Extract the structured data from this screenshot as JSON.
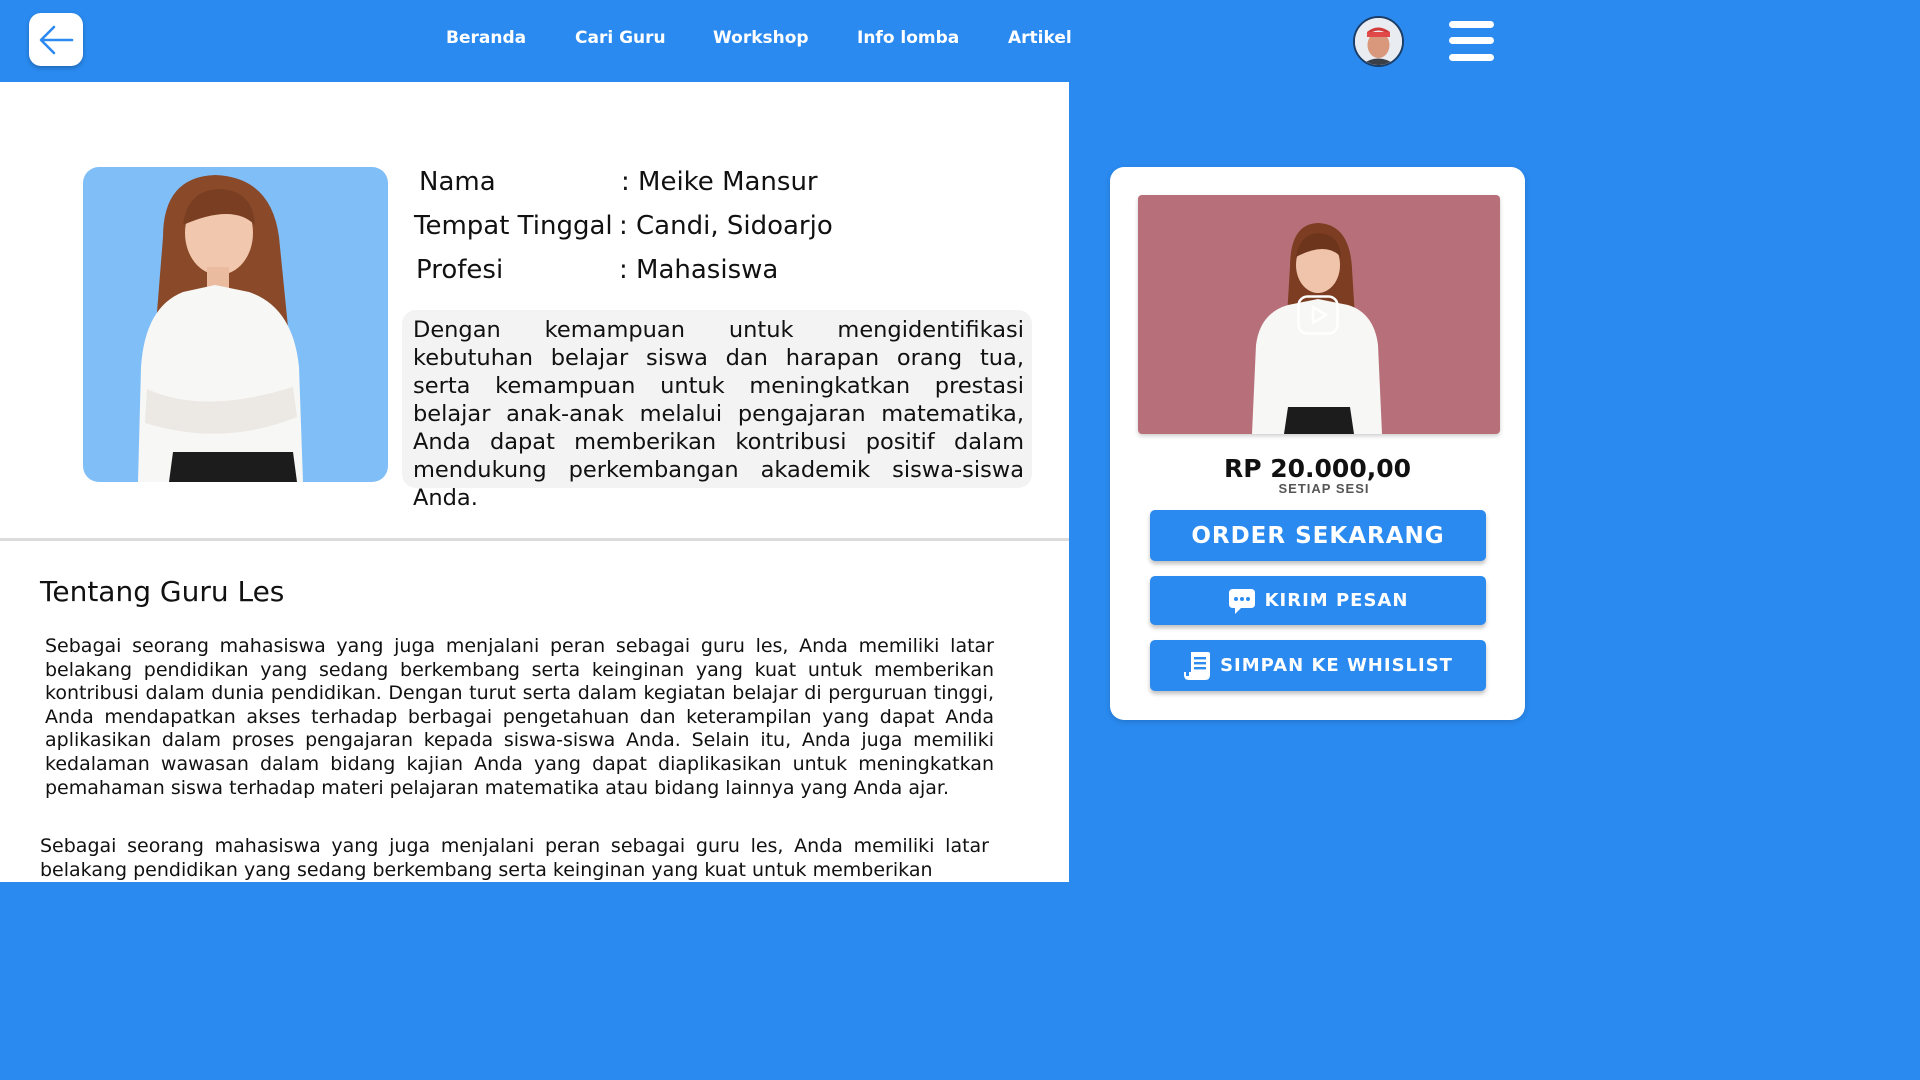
{
  "header": {
    "nav": [
      "Beranda",
      "Cari Guru",
      "Workshop",
      "Info lomba",
      "Artikel"
    ]
  },
  "profile": {
    "name_label": "Nama",
    "name_value": ": Meike Mansur",
    "residence_label": "Tempat Tinggal",
    "residence_value": ": Candi, Sidoarjo",
    "job_label": "Profesi",
    "job_value": ": Mahasiswa",
    "description": "Dengan kemampuan untuk mengidentifikasi kebutuhan belajar siswa dan harapan orang tua, serta kemampuan untuk meningkatkan prestasi belajar anak-anak melalui pengajaran matematika, Anda dapat memberikan kontribusi positif dalam mendukung perkembangan akademik siswa-siswa Anda."
  },
  "about": {
    "title": "Tentang Guru Les",
    "paragraph_1": "Sebagai seorang mahasiswa yang juga menjalani peran sebagai guru les, Anda memiliki latar belakang pendidikan yang sedang berkembang serta keinginan yang kuat untuk memberikan kontribusi dalam dunia pendidikan. Dengan turut serta dalam kegiatan belajar di perguruan tinggi, Anda mendapatkan akses terhadap berbagai pengetahuan dan keterampilan yang dapat Anda aplikasikan dalam proses pengajaran kepada siswa-siswa Anda. Selain itu, Anda juga memiliki kedalaman wawasan dalam bidang kajian Anda yang dapat diaplikasikan untuk meningkatkan pemahaman siswa terhadap materi pelajaran matematika atau bidang lainnya yang Anda ajar.",
    "paragraph_2": "Sebagai seorang mahasiswa yang juga menjalani peran sebagai guru les, Anda memiliki latar belakang pendidikan yang sedang berkembang serta keinginan yang kuat untuk memberikan"
  },
  "order": {
    "price": "RP 20.000,00",
    "price_unit": "SETIAP SESI",
    "order_button": "ORDER SEKARANG",
    "message_button": "KIRIM PESAN",
    "wishlist_button": "SIMPAN KE WHISLIST"
  },
  "colors": {
    "primary": "#2a8af0",
    "photo_bg": "#80bef8",
    "video_bg": "#b7707a"
  },
  "icons": [
    "back-arrow-icon",
    "hamburger-menu-icon",
    "play-icon",
    "chat-icon",
    "wishlist-icon"
  ]
}
